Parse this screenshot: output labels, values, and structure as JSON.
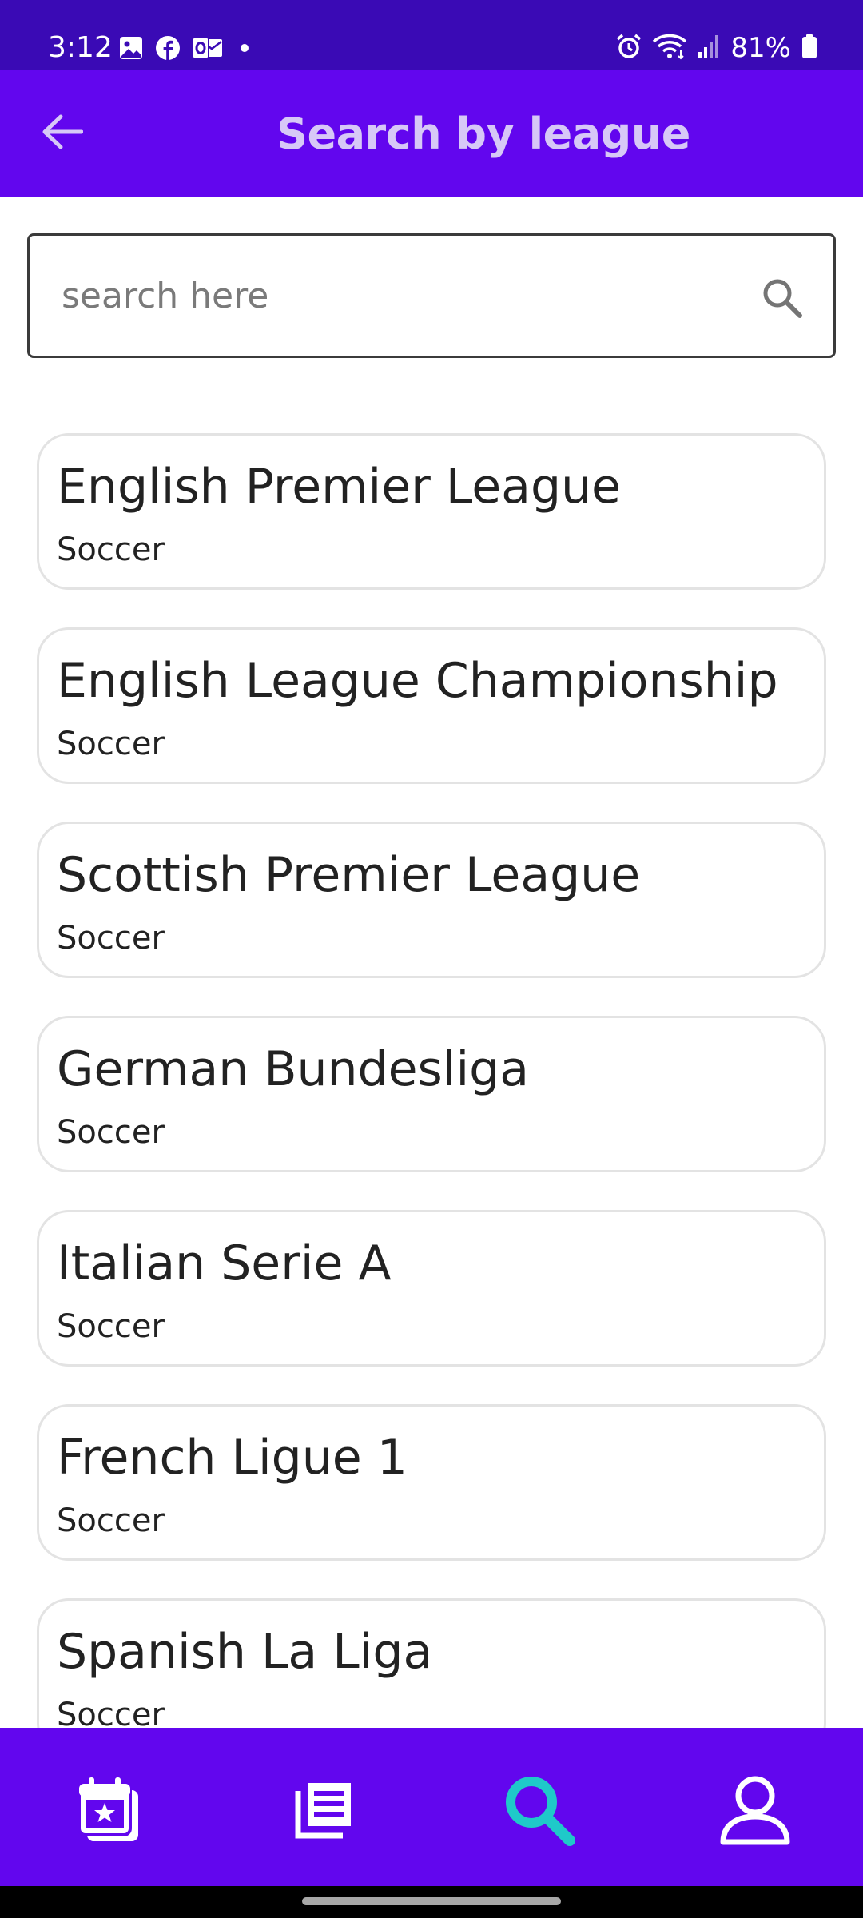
{
  "status_bar": {
    "time": "3:12",
    "battery": "81%",
    "icons": [
      "gallery-icon",
      "facebook-icon",
      "outlook-icon",
      "dot-icon",
      "alarm-icon",
      "wifi-icon",
      "signal-icon",
      "battery-icon"
    ]
  },
  "app_bar": {
    "title": "Search by league",
    "back_icon": "arrow-left-icon"
  },
  "search": {
    "placeholder": "search here",
    "value": "",
    "icon": "search-icon"
  },
  "leagues": [
    {
      "name": "English Premier League",
      "sport": "Soccer"
    },
    {
      "name": "English League Championship",
      "sport": "Soccer"
    },
    {
      "name": "Scottish Premier League",
      "sport": "Soccer"
    },
    {
      "name": "German Bundesliga",
      "sport": "Soccer"
    },
    {
      "name": "Italian Serie A",
      "sport": "Soccer"
    },
    {
      "name": "French Ligue 1",
      "sport": "Soccer"
    },
    {
      "name": "Spanish La Liga",
      "sport": "Soccer"
    }
  ],
  "bottom_nav": {
    "items": [
      {
        "icon": "calendar-star-icon",
        "active": false
      },
      {
        "icon": "news-icon",
        "active": false
      },
      {
        "icon": "search-icon",
        "active": true
      },
      {
        "icon": "profile-icon",
        "active": false
      }
    ]
  },
  "colors": {
    "status_bar": "#3a0ab5",
    "primary": "#6206ee",
    "title_text": "#d7c8f7",
    "active_nav": "#1fc9c9",
    "inactive_nav": "#ffffff"
  }
}
